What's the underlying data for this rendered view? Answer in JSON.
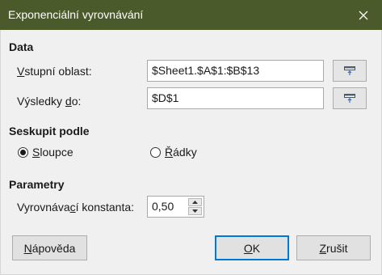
{
  "window": {
    "title": "Exponenciální vyrovnávání"
  },
  "data_section": {
    "title": "Data",
    "input_range": {
      "label_pre": "V",
      "label_post": "stupní oblast:",
      "value": "$Sheet1.$A$1:$B$13"
    },
    "results": {
      "label_pre": "Výsledky ",
      "label_u": "d",
      "label_post": "o:",
      "value": "$D$1"
    }
  },
  "group_by": {
    "title": "Seskupit podle",
    "columns": {
      "label_u": "S",
      "label_post": "loupce",
      "checked": true
    },
    "rows": {
      "label_u": "Ř",
      "label_post": "ádky",
      "checked": false
    }
  },
  "parameters": {
    "title": "Parametry",
    "constant": {
      "label_pre": "Vyrovnáva",
      "label_u": "c",
      "label_post": "í konstanta:",
      "value": "0,50"
    }
  },
  "buttons": {
    "help": {
      "label_u": "N",
      "label_post": "ápověda"
    },
    "ok": {
      "label_u": "O",
      "label_post": "K"
    },
    "cancel": {
      "label_u": "Z",
      "label_post": "rušit"
    }
  }
}
